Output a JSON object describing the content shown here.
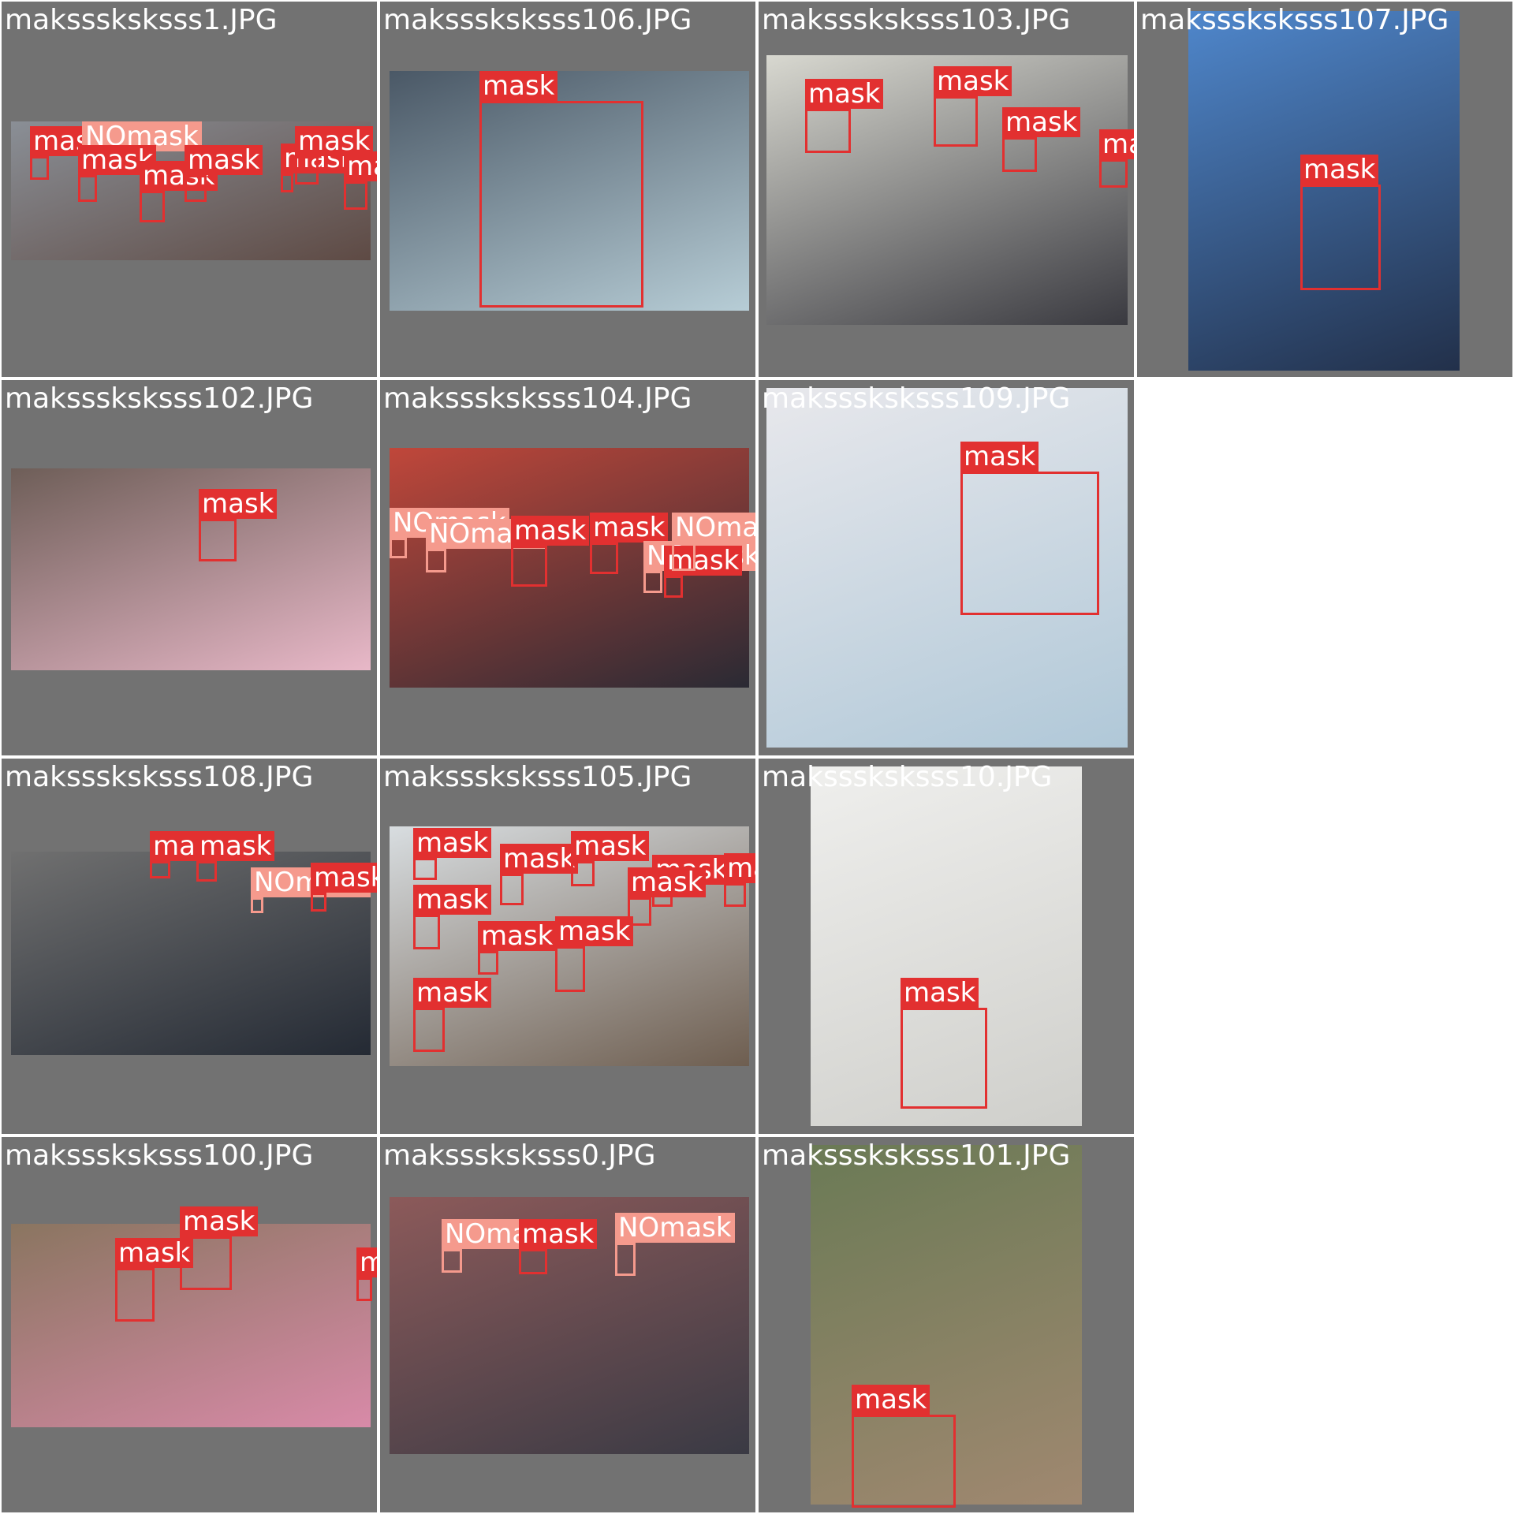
{
  "colors": {
    "tile_background": "#727272",
    "mask": "#e23030",
    "nomask": "#f59a8d"
  },
  "tiles": [
    {
      "filename": "maksssksksss1.JPG",
      "photo_tone": [
        "#8a8f96",
        "#5e4a44"
      ],
      "detections": [
        {
          "label": "mask"
        },
        {
          "label": "NOmask"
        },
        {
          "label": "mask"
        },
        {
          "label": "mask"
        },
        {
          "label": "mask"
        },
        {
          "label": "mask"
        },
        {
          "label": "mask"
        },
        {
          "label": "mask"
        }
      ]
    },
    {
      "filename": "maksssksksss106.JPG",
      "photo_tone": [
        "#4a5866",
        "#b7cdd6"
      ],
      "detections": [
        {
          "label": "mask"
        }
      ]
    },
    {
      "filename": "maksssksksss103.JPG",
      "photo_tone": [
        "#d8d8d0",
        "#3a3a40"
      ],
      "detections": [
        {
          "label": "mask"
        },
        {
          "label": "mask"
        },
        {
          "label": "mask"
        },
        {
          "label": "mask"
        }
      ]
    },
    {
      "filename": "maksssksksss107.JPG",
      "photo_tone": [
        "#4f87cc",
        "#22304a"
      ],
      "detections": [
        {
          "label": "mask"
        }
      ]
    },
    {
      "filename": "maksssksksss102.JPG",
      "photo_tone": [
        "#6e5e58",
        "#e8b8c8"
      ],
      "detections": [
        {
          "label": "mask"
        }
      ]
    },
    {
      "filename": "maksssksksss104.JPG",
      "photo_tone": [
        "#c0473a",
        "#2a2a34"
      ],
      "detections": [
        {
          "label": "NOmask"
        },
        {
          "label": "NOmask"
        },
        {
          "label": "mask"
        },
        {
          "label": "mask"
        },
        {
          "label": "NOmask"
        },
        {
          "label": "mask"
        },
        {
          "label": "NOmask"
        }
      ]
    },
    {
      "filename": "maksssksksss109.JPG",
      "photo_tone": [
        "#e8e8ec",
        "#b0c8d8"
      ],
      "detections": [
        {
          "label": "mask"
        }
      ]
    },
    {
      "filename": "maksssksksss108.JPG",
      "photo_tone": [
        "#707070",
        "#242a34"
      ],
      "detections": [
        {
          "label": "mask"
        },
        {
          "label": "mask"
        },
        {
          "label": "NOmask"
        },
        {
          "label": "mask"
        }
      ]
    },
    {
      "filename": "maksssksksss105.JPG",
      "photo_tone": [
        "#d8dde0",
        "#6e5e50"
      ],
      "detections": [
        {
          "label": "mask"
        },
        {
          "label": "mask"
        },
        {
          "label": "mask"
        },
        {
          "label": "mask"
        },
        {
          "label": "mask"
        },
        {
          "label": "mask"
        },
        {
          "label": "mask"
        },
        {
          "label": "mask"
        },
        {
          "label": "mask"
        },
        {
          "label": "mask"
        }
      ]
    },
    {
      "filename": "maksssksksss10.JPG",
      "photo_tone": [
        "#efefed",
        "#cfcfcb"
      ],
      "detections": [
        {
          "label": "mask"
        }
      ]
    },
    {
      "filename": "maksssksksss100.JPG",
      "photo_tone": [
        "#8a7560",
        "#d88aa8"
      ],
      "detections": [
        {
          "label": "mask"
        },
        {
          "label": "mask"
        },
        {
          "label": "mask"
        }
      ]
    },
    {
      "filename": "maksssksksss0.JPG",
      "photo_tone": [
        "#8c5a5a",
        "#3a3a44"
      ],
      "detections": [
        {
          "label": "NOmask"
        },
        {
          "label": "mask"
        },
        {
          "label": "NOmask"
        }
      ]
    },
    {
      "filename": "maksssksksss101.JPG",
      "photo_tone": [
        "#6a7a55",
        "#a08870"
      ],
      "detections": [
        {
          "label": "mask"
        }
      ]
    }
  ]
}
